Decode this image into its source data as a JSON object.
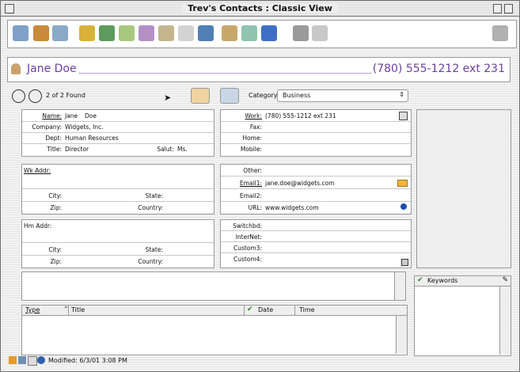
{
  "window": {
    "title": "Trev's Contacts : Classic View"
  },
  "contact": {
    "name_display": "Jane Doe",
    "phone_display": "(780) 555-1212 ext 231"
  },
  "nav": {
    "found_text": "2 of 2 Found",
    "category_label": "Category:",
    "category_value": "Business"
  },
  "fields": {
    "name_label": "Name:",
    "first_name": "Jane",
    "last_name": "Doe",
    "company_label": "Company:",
    "company": "Widgets, Inc.",
    "dept_label": "Dept:",
    "dept": "Human Resources",
    "title_label": "Title:",
    "title": "Director",
    "salut_label": "Salut:",
    "salut": "Ms.",
    "wk_addr_label": "Wk Addr:",
    "city_label": "City:",
    "state_label": "State:",
    "zip_label": "Zip:",
    "country_label": "Country:",
    "hm_addr_label": "Hm Addr:",
    "work_label": "Work:",
    "work": "(780) 555-1212 ext 231",
    "fax_label": "Fax:",
    "home_label": "Home:",
    "mobile_label": "Mobile:",
    "other_label": "Other:",
    "email1_label": "Email1:",
    "email1": "jane.doe@widgets.com",
    "email2_label": "Email2:",
    "url_label": "URL:",
    "url": "www.widgets.com",
    "switchbd_label": "Switchbd:",
    "internet_label": "InterNet:",
    "custom3_label": "Custom3:",
    "custom4_label": "Custom4:"
  },
  "keywords": {
    "header": "Keywords"
  },
  "activity_table": {
    "columns": [
      "Type",
      "Title",
      "Date",
      "Time"
    ]
  },
  "status": {
    "modified": "Modified: 6/3/01 3:08 PM"
  },
  "icons": {
    "toolbar": [
      "flag-icon",
      "new-record-icon",
      "find-record-icon",
      "edit-record-icon",
      "book-icon",
      "note-icon",
      "copy-card-icon",
      "letter-icon",
      "key-icon",
      "globe-icon",
      "document-icon",
      "network-icon",
      "web-icon",
      "print-icon",
      "trash-icon",
      "tools-icon"
    ]
  },
  "colors": {
    "name_text": "#6b3fa0",
    "phone_text": "#6b3fa0"
  }
}
